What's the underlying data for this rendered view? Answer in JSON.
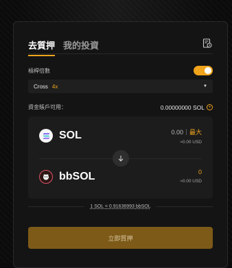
{
  "tabs": [
    {
      "label": "去質押",
      "active": true
    },
    {
      "label": "我的投資",
      "active": false
    }
  ],
  "icons": {
    "history": "history-doc-icon",
    "plus": "plus-circle-icon",
    "arrow": "arrow-down-icon",
    "caret": "caret-down-icon"
  },
  "leverage": {
    "label": "槓桿倍數",
    "enabled": true
  },
  "select": {
    "mode": "Cross",
    "leverage": "4x"
  },
  "available": {
    "label": "資金賬戶可用：",
    "value": "0.00000000 SOL"
  },
  "from": {
    "token": "SOL",
    "amount": "0.00",
    "max_label": "最大",
    "usd": "≈0.00 USD"
  },
  "to": {
    "token": "bbSOL",
    "amount": "0",
    "usd": "≈0.00 USD"
  },
  "rate": "1 SOL = 0.91636993 bbSOL",
  "submit_label": "立即質押",
  "colors": {
    "accent": "#f0a41c",
    "button_bg": "#7d5a18",
    "card_bg": "#141414"
  }
}
